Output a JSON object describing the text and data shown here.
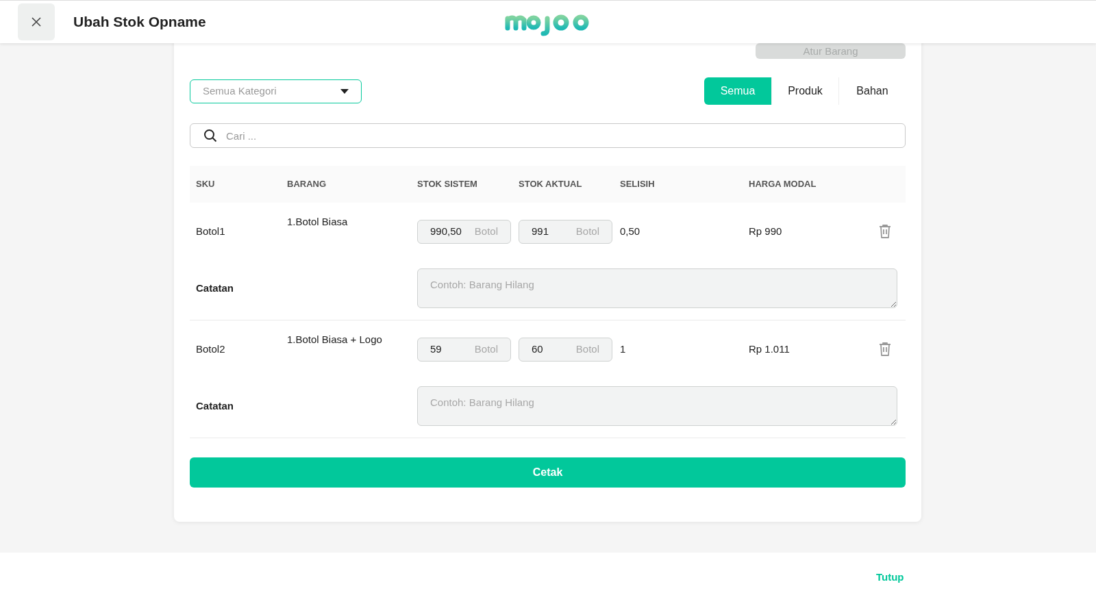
{
  "header": {
    "title": "Ubah Stok Opname"
  },
  "atur_button": "Atur Barang",
  "category_dropdown": {
    "placeholder": "Semua Kategori"
  },
  "tabs": [
    {
      "label": "Semua",
      "selected": true
    },
    {
      "label": "Produk",
      "selected": false
    },
    {
      "label": "Bahan",
      "selected": false
    }
  ],
  "search": {
    "placeholder": "Cari ..."
  },
  "table": {
    "columns": [
      "SKU",
      "BARANG",
      "STOK SISTEM",
      "STOK AKTUAL",
      "SELISIH",
      "HARGA MODAL"
    ],
    "rows": [
      {
        "sku": "Botol1",
        "item": "1.Botol Biasa",
        "stok_sistem": {
          "value": "990,50",
          "unit": "Botol"
        },
        "stok_aktual": {
          "value": "991",
          "unit": "Botol"
        },
        "selisih": "0,50",
        "harga_modal": "Rp 990",
        "note_label": "Catatan",
        "note_placeholder": "Contoh: Barang Hilang"
      },
      {
        "sku": "Botol2",
        "item": "1.Botol Biasa + Logo",
        "stok_sistem": {
          "value": "59",
          "unit": "Botol"
        },
        "stok_aktual": {
          "value": "60",
          "unit": "Botol"
        },
        "selisih": "1",
        "harga_modal": "Rp 1.011",
        "note_label": "Catatan",
        "note_placeholder": "Contoh: Barang Hilang"
      }
    ]
  },
  "print_button": "Cetak",
  "footer": {
    "close_link": "Tutup"
  }
}
